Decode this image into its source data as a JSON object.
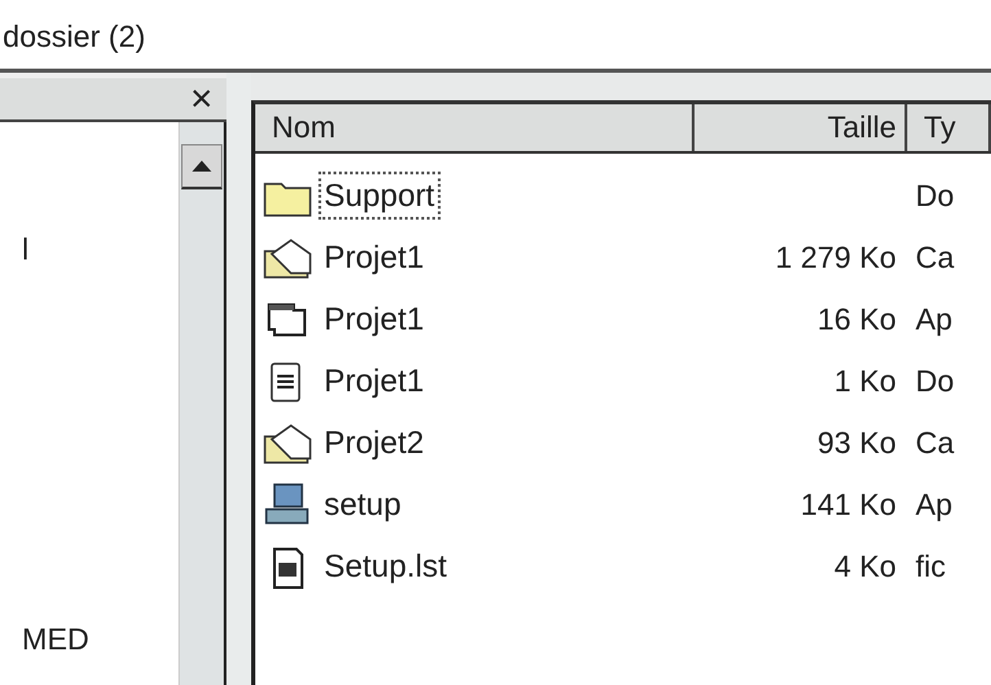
{
  "window": {
    "title": "dossier (2)"
  },
  "left_pane": {
    "close": "×",
    "items": [
      "l",
      "MED"
    ]
  },
  "table": {
    "columns": [
      "Nom",
      "Taille",
      "Ty"
    ],
    "rows": [
      {
        "kind": "folder",
        "name": "Support",
        "size": "",
        "type": "Do",
        "selected": true
      },
      {
        "kind": "cabinet",
        "name": "Projet1",
        "size": "1 279 Ko",
        "type": "Ca",
        "selected": false
      },
      {
        "kind": "app",
        "name": "Projet1",
        "size": "16 Ko",
        "type": "Ap",
        "selected": false
      },
      {
        "kind": "notepad",
        "name": "Projet1",
        "size": "1 Ko",
        "type": "Do",
        "selected": false
      },
      {
        "kind": "cabinet",
        "name": "Projet2",
        "size": "93 Ko",
        "type": "Ca",
        "selected": false
      },
      {
        "kind": "setup",
        "name": "setup",
        "size": "141 Ko",
        "type": "Ap",
        "selected": false
      },
      {
        "kind": "list",
        "name": "Setup.lst",
        "size": "4 Ko",
        "type": "fic",
        "selected": false
      }
    ]
  }
}
